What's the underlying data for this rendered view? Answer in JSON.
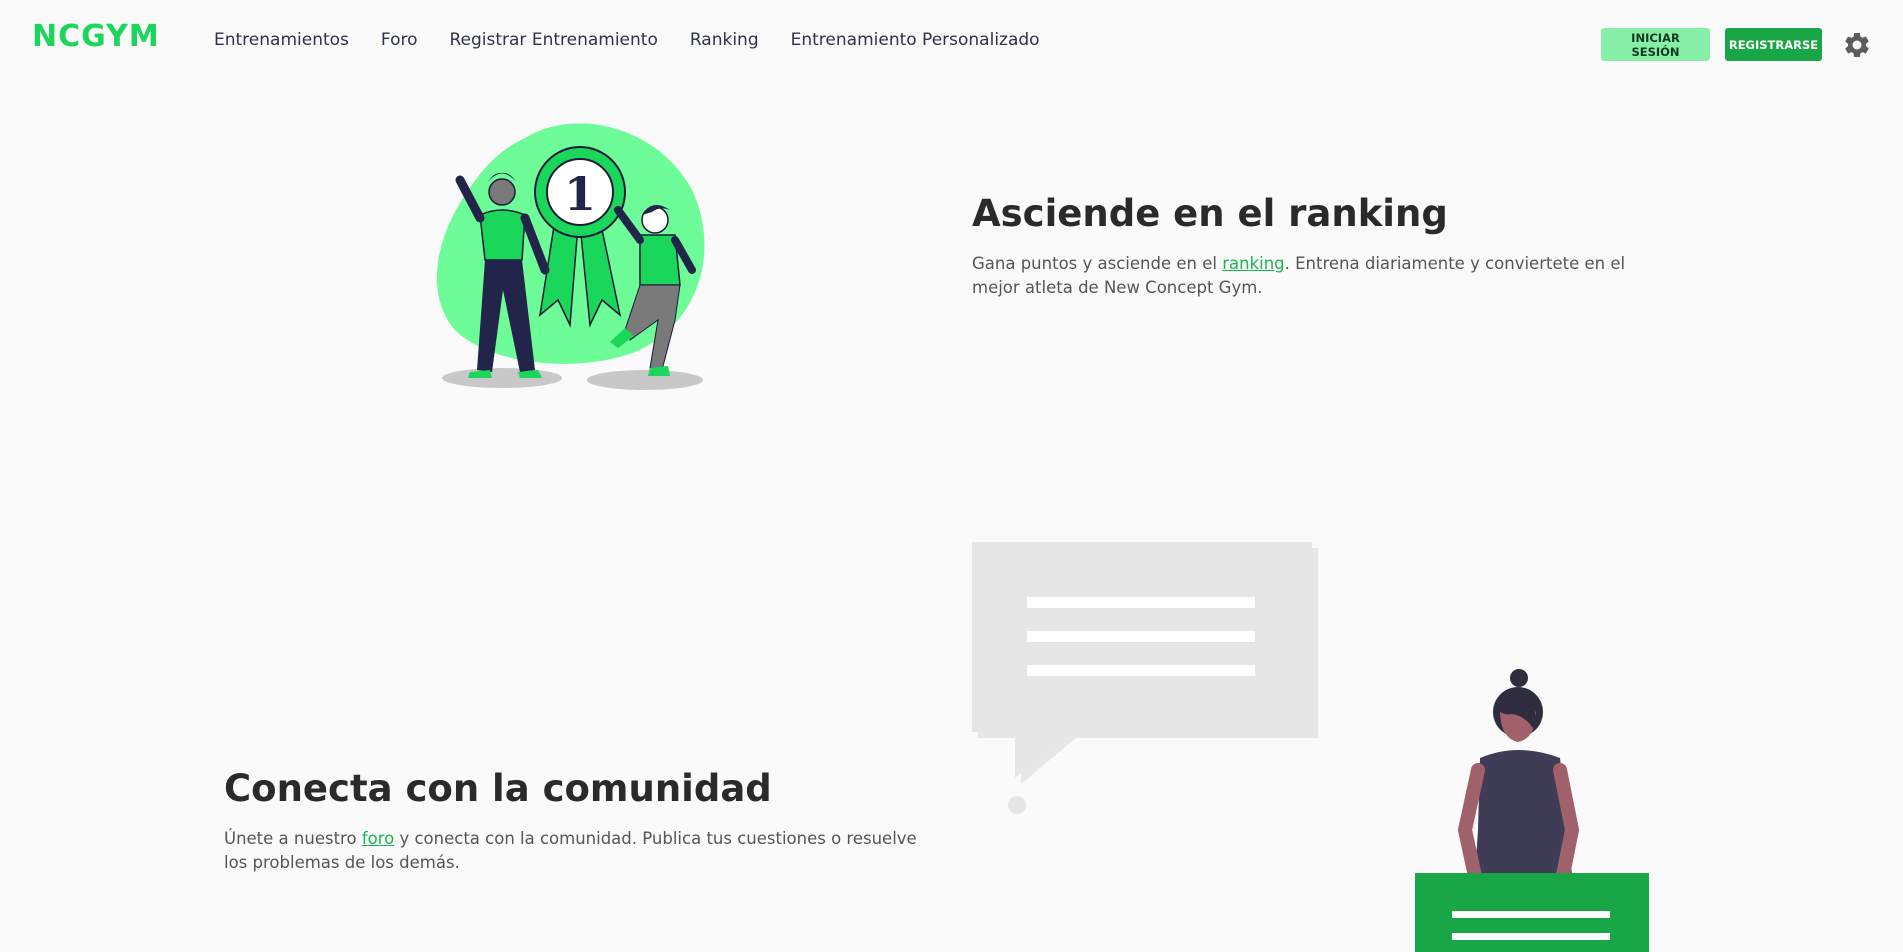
{
  "header": {
    "logo_text": "NCGYM",
    "nav": [
      {
        "label": "Entrenamientos"
      },
      {
        "label": "Foro"
      },
      {
        "label": "Registrar Entrenamiento"
      },
      {
        "label": "Ranking"
      },
      {
        "label": "Entrenamiento Personalizado"
      }
    ],
    "login_label": "INICIAR SESIÓN",
    "register_label": "REGISTRARSE",
    "settings_icon": "gear-icon"
  },
  "section_ranking": {
    "title": "Asciende en el ranking",
    "text_before": "Gana puntos y asciende en el ",
    "link": "ranking",
    "text_after": ". Entrena diariamente y conviertete en el mejor atleta de New Concept Gym.",
    "badge_number": "1"
  },
  "section_forum": {
    "title": "Conecta con la comunidad",
    "text_before": "Únete a nuestro ",
    "link": "foro",
    "text_after": " y conecta con la comunidad. Publica tus cuestiones o resuelve los problemas de los demás."
  },
  "colors": {
    "accent": "#1ad65a",
    "accent_dark": "#19a646",
    "accent_light": "#86f0a8",
    "figure_dark": "#3f3d56"
  }
}
